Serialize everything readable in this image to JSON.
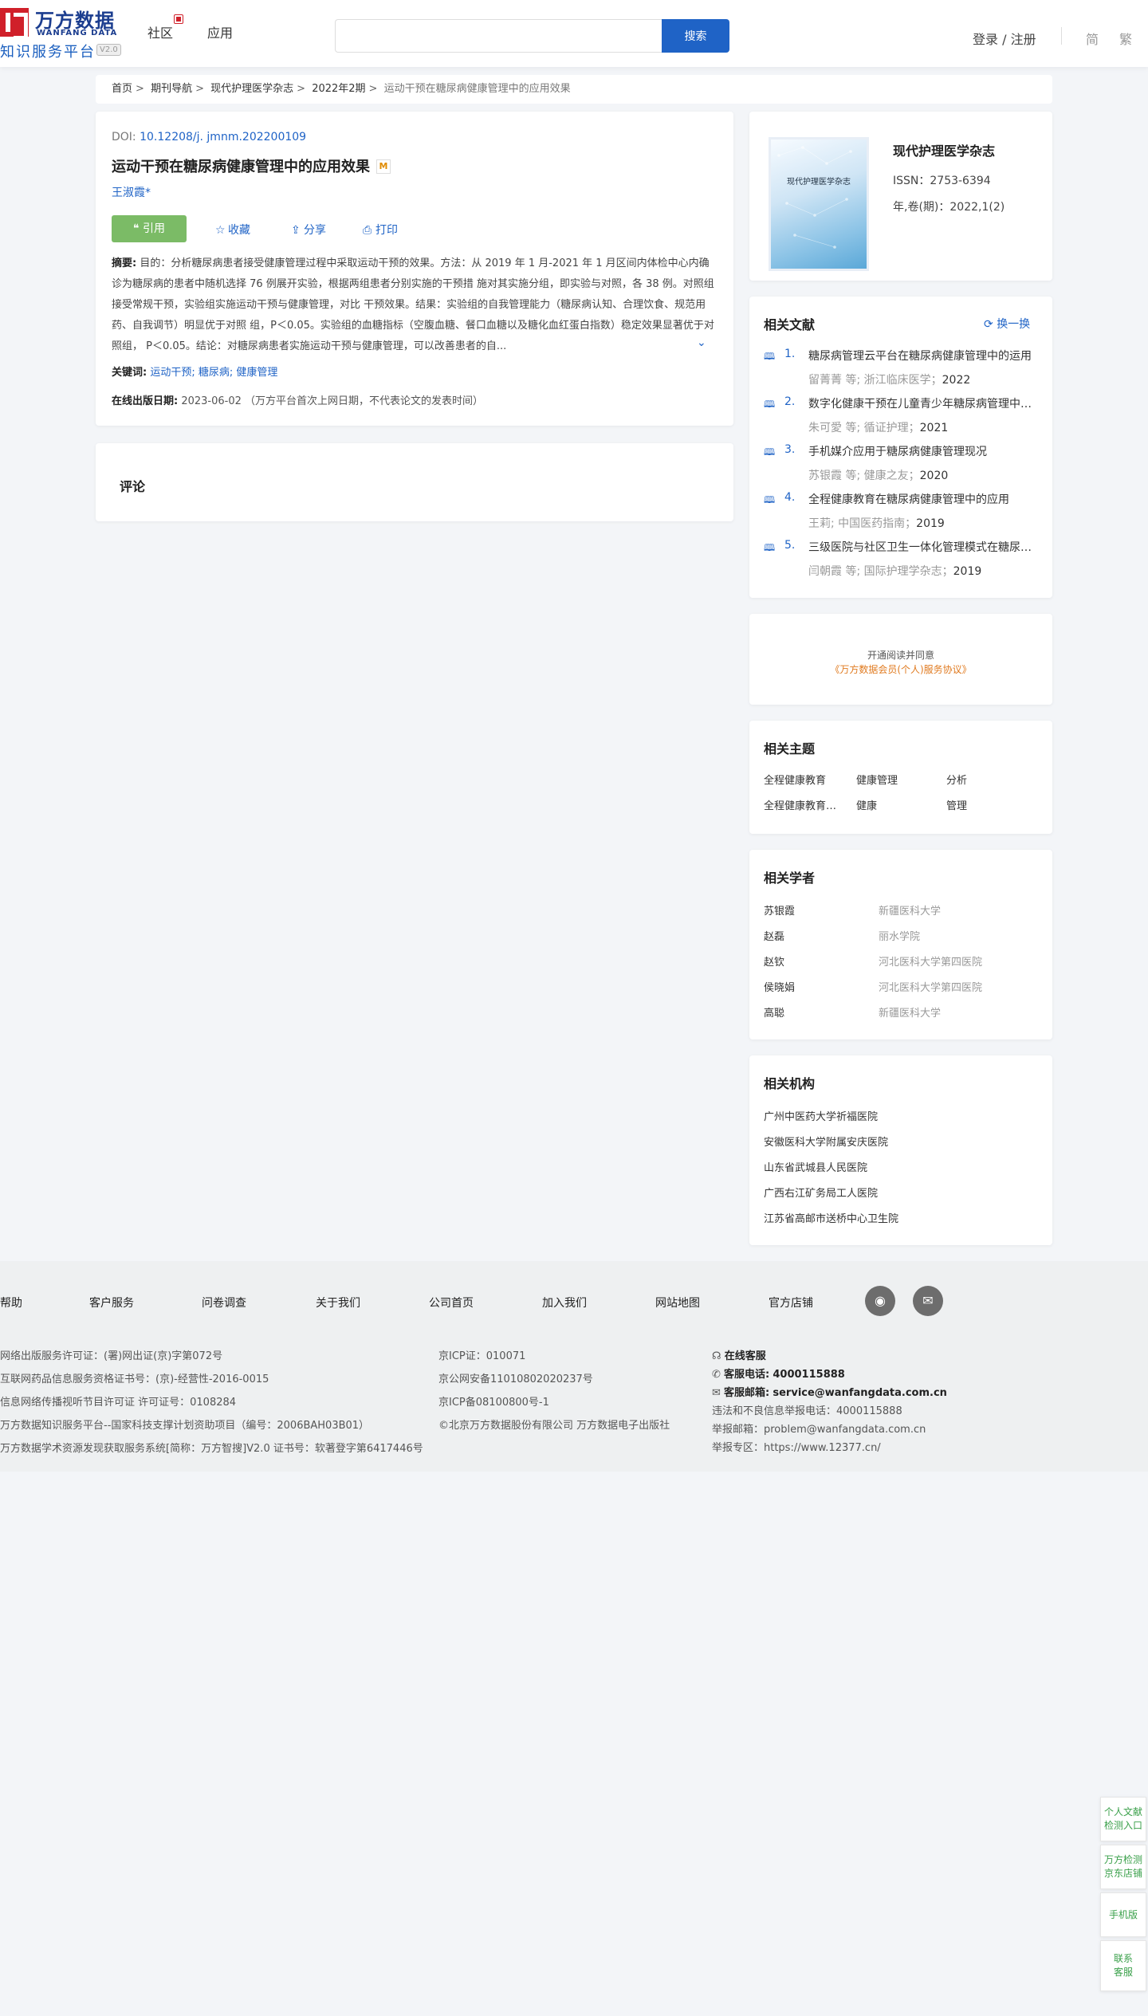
{
  "header": {
    "logo_cn": "万方数据",
    "logo_en": "WANFANG DATA",
    "logo_sub": "知识服务平台",
    "logo_version": "V2.0",
    "nav": [
      "社区",
      "应用"
    ],
    "search_placeholder": "",
    "search_button": "搜索",
    "login": "登录 / 注册",
    "lang_simplified": "简",
    "lang_traditional": "繁"
  },
  "breadcrumb": {
    "items": [
      "首页",
      "期刊导航",
      "现代护理医学杂志",
      "2022年2期"
    ],
    "current": "运动干预在糖尿病健康管理中的应用效果"
  },
  "article": {
    "doi_label": "DOI:",
    "doi": "10.12208/j. jmnm.202200109",
    "title": "运动干预在糖尿病健康管理中的应用效果",
    "m_badge": "M",
    "author": "王淑霞*",
    "actions": {
      "cite": "引用",
      "favorite": "收藏",
      "share": "分享",
      "print": "打印"
    },
    "abstract_label": "摘要:",
    "abstract": "目的：分析糖尿病患者接受健康管理过程中采取运动干预的效果。方法：从 2019 年 1 月-2021 年 1 月区间内体检中心内确诊为糖尿病的患者中随机选择 76 例展开实验，根据两组患者分别实施的干预措 施对其实施分组，即实验与对照，各 38 例。对照组接受常规干预，实验组实施运动干预与健康管理，对比 干预效果。结果：实验组的自我管理能力（糖尿病认知、合理饮食、规范用药、自我调节）明显优于对照 组，P＜0.05。实验组的血糖指标（空腹血糖、餐口血糖以及糖化血红蛋白指数）稳定效果显著优于对照组， P＜0.05。结论：对糖尿病患者实施运动干预与健康管理，可以改善患者的自...",
    "keywords_label": "关键词:",
    "keywords": [
      "运动干预;",
      "糖尿病;",
      "健康管理"
    ],
    "pubdate_label": "在线出版日期:",
    "pubdate": "2023-06-02  （万方平台首次上网日期，不代表论文的发表时间）"
  },
  "comment": {
    "title": "评论"
  },
  "journal": {
    "cover_text": "现代护理医学杂志",
    "name": "现代护理医学杂志",
    "issn": "ISSN：2753-6394",
    "volume": "年,卷(期)：2022,1(2)"
  },
  "related_docs": {
    "title": "相关文献",
    "refresh": "换一换",
    "items": [
      {
        "num": "1.",
        "title": "糖尿病管理云平台在糖尿病健康管理中的运用",
        "authors": "留菁菁  等;  浙江临床医学；",
        "year": "2022"
      },
      {
        "num": "2.",
        "title": "数字化健康干预在儿童青少年糖尿病管理中的应用",
        "authors": "朱可愛  等;  循证护理；",
        "year": "2021"
      },
      {
        "num": "3.",
        "title": "手机媒介应用于糖尿病健康管理现况",
        "authors": "苏银霞  等;  健康之友；",
        "year": "2020"
      },
      {
        "num": "4.",
        "title": "全程健康教育在糖尿病健康管理中的应用",
        "authors": "王莉;  中国医药指南；",
        "year": "2019"
      },
      {
        "num": "5.",
        "title": "三级医院与社区卫生一体化管理模式在糖尿病健康管理中的应用",
        "authors": "闫朝霞  等;  国际护理学杂志；",
        "year": "2019"
      }
    ]
  },
  "agreement": {
    "line1": "开通阅读并同意",
    "line2": "《万方数据会员(个人)服务协议》"
  },
  "related_topics": {
    "title": "相关主题",
    "items": [
      "全程健康教育",
      "健康管理",
      "分析",
      "全程健康教育模式",
      "健康",
      "管理"
    ]
  },
  "related_scholars": {
    "title": "相关学者",
    "items": [
      {
        "name": "苏银霞",
        "org": "新疆医科大学"
      },
      {
        "name": "赵磊",
        "org": "丽水学院"
      },
      {
        "name": "赵钦",
        "org": "河北医科大学第四医院"
      },
      {
        "name": "侯晓娟",
        "org": "河北医科大学第四医院"
      },
      {
        "name": "高聪",
        "org": "新疆医科大学"
      }
    ]
  },
  "related_orgs": {
    "title": "相关机构",
    "items": [
      "广州中医药大学祈福医院",
      "安徽医科大学附属安庆医院",
      "山东省武城县人民医院",
      "广西右江矿务局工人医院",
      "江苏省高邮市送桥中心卫生院"
    ]
  },
  "footer": {
    "links": [
      "帮助",
      "客户服务",
      "问卷调查",
      "关于我们",
      "公司首页",
      "加入我们",
      "网站地图",
      "官方店铺"
    ],
    "col1": [
      "网络出版服务许可证：(署)网出证(京)字第072号",
      "互联网药品信息服务资格证书号：(京)-经营性-2016-0015",
      "信息网络传播视听节目许可证 许可证号：0108284",
      "万方数据知识服务平台--国家科技支撑计划资助项目（编号：2006BAH03B01）",
      "万方数据学术资源发现获取服务系统[简称：万方智搜]V2.0 证书号：软著登字第6417446号"
    ],
    "col2": [
      "京ICP证：010071",
      "京公网安备11010802020237号",
      "京ICP备08100800号-1",
      "©北京万方数据股份有限公司 万方数据电子出版社"
    ],
    "online_service": "在线客服",
    "phone_label": "客服电话:",
    "phone": "4000115888",
    "email_label": "客服邮箱:",
    "email": "service@wanfangdata.com.cn",
    "report_phone": "违法和不良信息举报电话：4000115888",
    "report_email": "举报邮箱：problem@wanfangdata.com.cn",
    "report_site": "举报专区：https://www.12377.cn/"
  },
  "float": {
    "item1_l1": "个人文献",
    "item1_l2": "检测入口",
    "item2_l1": "万方检测",
    "item2_l2": "京东店铺",
    "item3": "手机版",
    "item4_l1": "联系",
    "item4_l2": "客服"
  }
}
